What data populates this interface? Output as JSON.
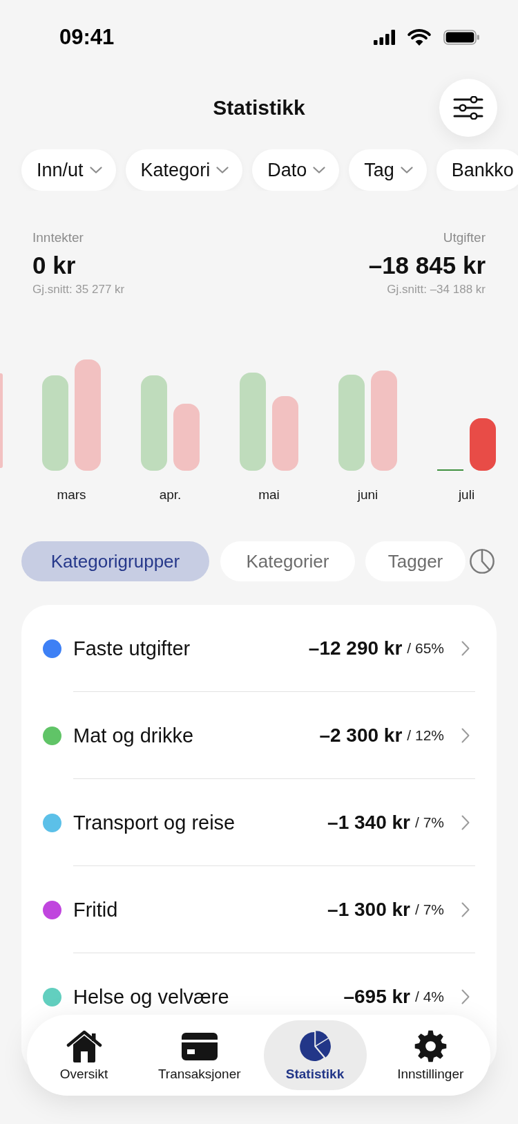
{
  "status_bar": {
    "time": "09:41"
  },
  "header": {
    "title": "Statistikk"
  },
  "filters": [
    {
      "label": "Inn/ut",
      "chevron": true
    },
    {
      "label": "Kategori",
      "chevron": true
    },
    {
      "label": "Dato",
      "chevron": true
    },
    {
      "label": "Tag",
      "chevron": true
    },
    {
      "label": "Bankko",
      "chevron": false
    }
  ],
  "summary": {
    "income": {
      "label": "Inntekter",
      "amount": "0 kr",
      "average": "Gj.snitt: 35 277 kr"
    },
    "expenses": {
      "label": "Utgifter",
      "amount": "–18 845 kr",
      "average": "Gj.snitt: –34 188 kr"
    }
  },
  "chart": {
    "months": [
      {
        "label": "mars",
        "selected": false
      },
      {
        "label": "apr.",
        "selected": false
      },
      {
        "label": "mai",
        "selected": false
      },
      {
        "label": "juni",
        "selected": false
      },
      {
        "label": "juli",
        "selected": true
      }
    ]
  },
  "tabs": [
    {
      "label": "Kategorigrupper",
      "selected": true
    },
    {
      "label": "Kategorier",
      "selected": false
    },
    {
      "label": "Tagger",
      "selected": false
    }
  ],
  "categories": [
    {
      "name": "Faste utgifter",
      "amount": "–12 290 kr",
      "share": "/ 65%",
      "color": "#3d80f5"
    },
    {
      "name": "Mat og drikke",
      "amount": "–2 300 kr",
      "share": "/ 12%",
      "color": "#60c467"
    },
    {
      "name": "Transport og reise",
      "amount": "–1 340 kr",
      "share": "/ 7%",
      "color": "#5cc0e8"
    },
    {
      "name": "Fritid",
      "amount": "–1 300 kr",
      "share": "/ 7%",
      "color": "#c045de"
    },
    {
      "name": "Helse og velvære",
      "amount": "–695 kr",
      "share": "/ 4%",
      "color": "#62cfbf"
    }
  ],
  "nav": [
    {
      "label": "Oversikt",
      "selected": false
    },
    {
      "label": "Transaksjoner",
      "selected": false
    },
    {
      "label": "Statistikk",
      "selected": true
    },
    {
      "label": "Innstillinger",
      "selected": false
    }
  ]
}
